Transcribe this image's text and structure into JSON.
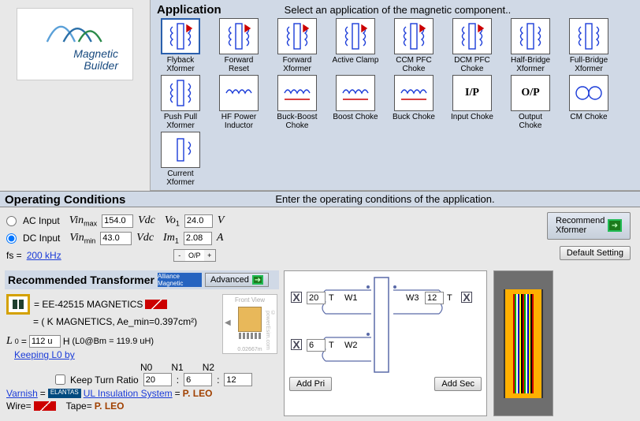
{
  "logo": {
    "line1": "Magnetic",
    "line2": "Builder"
  },
  "app": {
    "title": "Application",
    "hint": "Select an application of the magnetic component..",
    "items": [
      {
        "label": "Flyback Xformer",
        "selected": true
      },
      {
        "label": "Forward Reset"
      },
      {
        "label": "Forward Xformer"
      },
      {
        "label": "Active Clamp"
      },
      {
        "label": "CCM PFC Choke"
      },
      {
        "label": "DCM PFC Choke"
      },
      {
        "label": "Half-Bridge Xformer"
      },
      {
        "label": "Full-Bridge Xformer"
      },
      {
        "label": "Push Pull Xformer"
      },
      {
        "label": "HF Power Inductor"
      },
      {
        "label": "Buck-Boost Choke"
      },
      {
        "label": "Boost Choke"
      },
      {
        "label": "Buck Choke"
      },
      {
        "label": "Input Choke",
        "text": "I/P"
      },
      {
        "label": "Output Choke",
        "text": "O/P"
      },
      {
        "label": "CM Choke"
      },
      {
        "label": "Current Xformer"
      }
    ]
  },
  "opcond": {
    "title": "Operating Conditions",
    "hint": "Enter the operating conditions of the application.",
    "ac_label": "AC Input",
    "dc_label": "DC Input",
    "input_mode": "DC",
    "vinmax_label": "Vin",
    "vinmax_sub": "max",
    "vinmax": "154.0",
    "vdc": "Vdc",
    "vo1_label": "Vo",
    "vo1_sub": "1",
    "vo1": "24.0",
    "vo1_unit": "V",
    "vinmin_label": "Vin",
    "vinmin_sub": "min",
    "vinmin": "43.0",
    "im1_label": "Im",
    "im1_sub": "1",
    "im1": "2.08",
    "im1_unit": "A",
    "fs_label": "fs =",
    "fs_value": "200 kHz",
    "op_spinner": "O/P",
    "recommend_btn": "Recommend Xformer",
    "default_btn": "Default Setting"
  },
  "rec": {
    "title": "Recommended Transformer",
    "alliance_badge": "Alliance Magnetic",
    "advanced_btn": "Advanced",
    "core1": "= EE-42515 MAGNETICS",
    "core2": "= ( K MAGNETICS, Ae_min=0.397cm²)",
    "L0_label": "L",
    "L0_sub": "0",
    "L0_eq": "=",
    "L0_val": "112 u",
    "L0_unit": "H",
    "L0_note": "(L0@Bm = 119.9 uH)",
    "keeping_link": "Keeping L0 by",
    "N0": "N0",
    "N1": "N1",
    "N2": "N2",
    "keep_ratio": "Keep Turn Ratio",
    "n0v": "20",
    "n1v": "6",
    "n2v": "12",
    "varnish_label": "Varnish",
    "elantas": "ELANTAS",
    "ulins": "UL Insulation System",
    "pleo": "P. LEO",
    "wire_label": "Wire=",
    "tape_label": "Tape=",
    "front_view": "Front View",
    "fv_dim": "0.02667m"
  },
  "wind": {
    "W1": "W1",
    "W2": "W2",
    "W3": "W3",
    "n_w1": "20",
    "n_w2": "6",
    "n_w3": "12",
    "T": "T",
    "add_pri": "Add Pri",
    "add_sec": "Add Sec"
  }
}
